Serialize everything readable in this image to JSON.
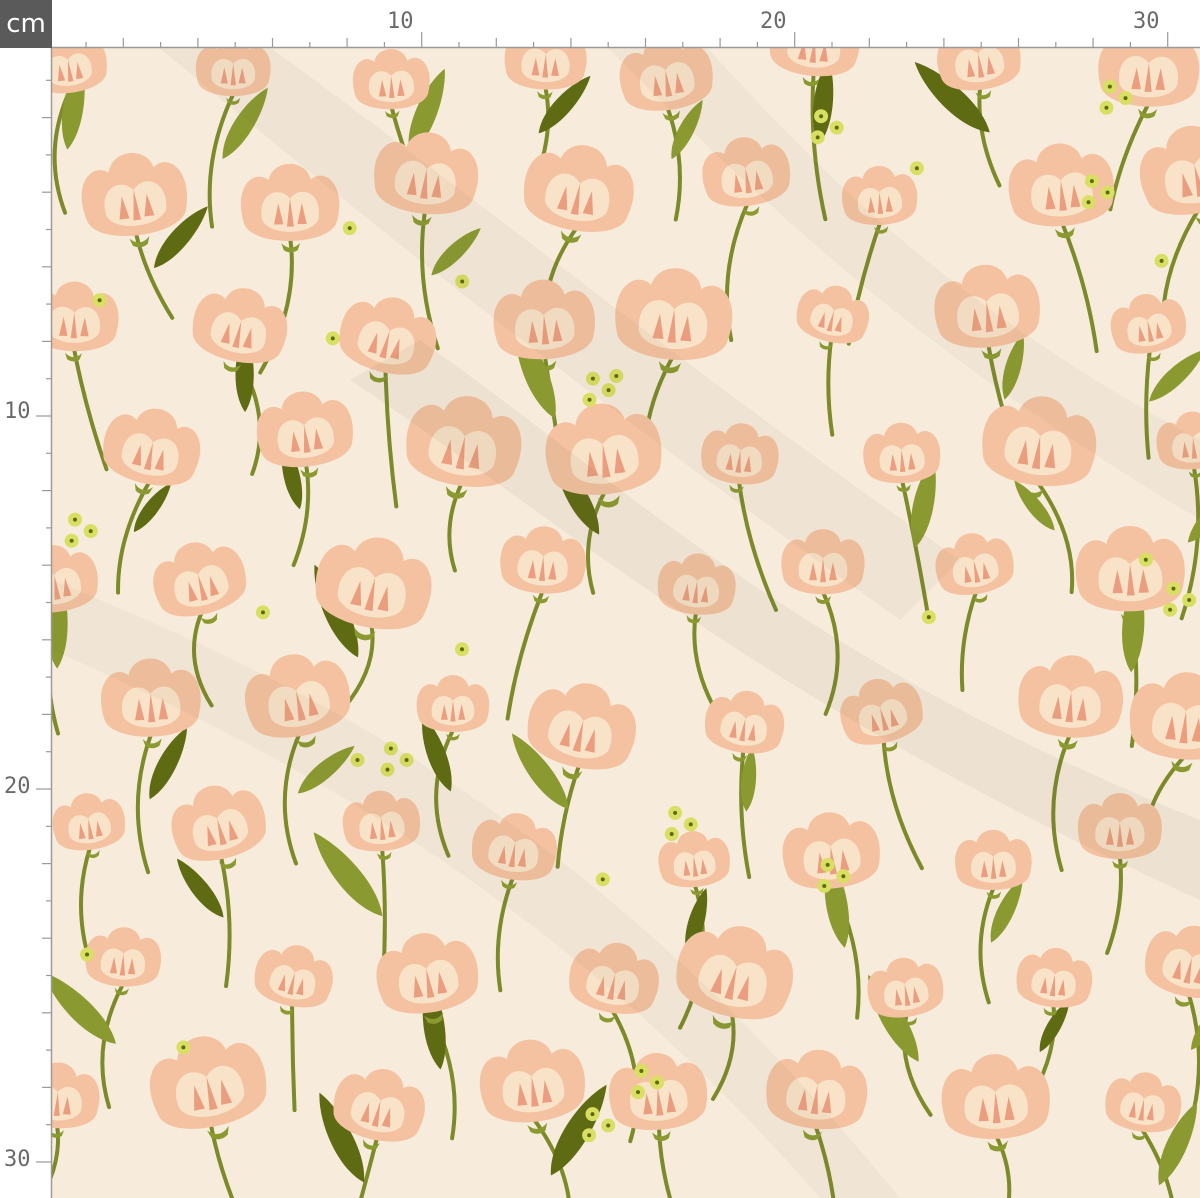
{
  "ruler": {
    "unit": "cm",
    "top_labels": [
      "10",
      "20",
      "30"
    ],
    "left_labels": [
      "10",
      "20",
      "30"
    ]
  },
  "colors": {
    "background": "#f7ecdc",
    "ruler_bg": "#ffffff",
    "ruler_tick": "#9a9a9a",
    "unit_box": "#5a5a5a",
    "petal": "#f4c2a0",
    "petal_light": "#f8e2c8",
    "petal_accent": "#eb9e7f",
    "stem": "#7c8a2a",
    "leaf_dark": "#5f6b12",
    "leaf_light": "#8a9a30",
    "dot": "#d9df62"
  },
  "pattern": {
    "motif": "peach tulip floral print on cream fabric"
  }
}
